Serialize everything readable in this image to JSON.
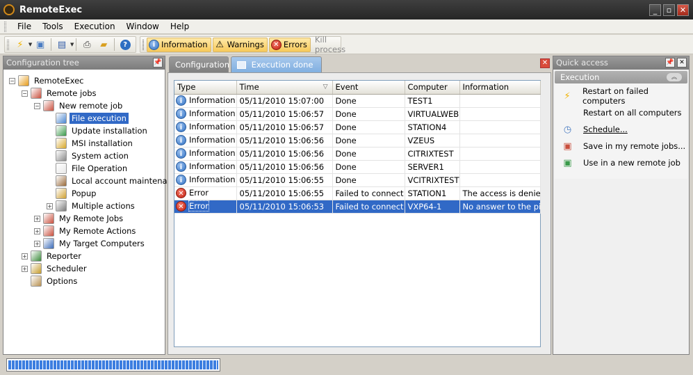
{
  "app": {
    "title": "RemoteExec"
  },
  "menu": [
    "File",
    "Tools",
    "Execution",
    "Window",
    "Help"
  ],
  "toolbar": {
    "icons": [
      "lightning-icon",
      "new-icon",
      "save-icon",
      "print-icon",
      "open-folder-icon",
      "help-icon"
    ],
    "filters": [
      {
        "label": "Information",
        "icon": "info-icon"
      },
      {
        "label": "Warnings",
        "icon": "warning-icon"
      },
      {
        "label": "Errors",
        "icon": "error-icon"
      }
    ],
    "kill_label": "Kill process"
  },
  "tree": {
    "title": "Configuration tree",
    "items": [
      {
        "label": "RemoteExec",
        "level": 0,
        "expander": "-"
      },
      {
        "label": "Remote jobs",
        "level": 1,
        "expander": "-"
      },
      {
        "label": "New remote job",
        "level": 2,
        "expander": "-"
      },
      {
        "label": "File execution",
        "level": 3,
        "expander": "",
        "selected": true
      },
      {
        "label": "Update installation",
        "level": 3,
        "expander": ""
      },
      {
        "label": "MSI installation",
        "level": 3,
        "expander": ""
      },
      {
        "label": "System action",
        "level": 3,
        "expander": ""
      },
      {
        "label": "File Operation",
        "level": 3,
        "expander": ""
      },
      {
        "label": "Local account maintenance",
        "level": 3,
        "expander": ""
      },
      {
        "label": "Popup",
        "level": 3,
        "expander": ""
      },
      {
        "label": "Multiple actions",
        "level": 3,
        "expander": "+"
      },
      {
        "label": "My Remote Jobs",
        "level": 2,
        "expander": "+"
      },
      {
        "label": "My Remote Actions",
        "level": 2,
        "expander": "+"
      },
      {
        "label": "My Target Computers",
        "level": 2,
        "expander": "+"
      },
      {
        "label": "Reporter",
        "level": 1,
        "expander": "+"
      },
      {
        "label": "Scheduler",
        "level": 1,
        "expander": "+"
      },
      {
        "label": "Options",
        "level": 1,
        "expander": ""
      }
    ]
  },
  "tabs": [
    {
      "label": "Configuration",
      "active": false
    },
    {
      "label": "Execution done",
      "active": true
    }
  ],
  "grid": {
    "columns": [
      "Type",
      "Time",
      "Event",
      "Computer",
      "Information"
    ],
    "rows": [
      {
        "type": "Information",
        "time": "05/11/2010 15:07:00",
        "event": "Done",
        "computer": "TEST1",
        "info": ""
      },
      {
        "type": "Information",
        "time": "05/11/2010 15:06:57",
        "event": "Done",
        "computer": "VIRTUALWEB",
        "info": ""
      },
      {
        "type": "Information",
        "time": "05/11/2010 15:06:57",
        "event": "Done",
        "computer": "STATION4",
        "info": ""
      },
      {
        "type": "Information",
        "time": "05/11/2010 15:06:56",
        "event": "Done",
        "computer": "VZEUS",
        "info": ""
      },
      {
        "type": "Information",
        "time": "05/11/2010 15:06:56",
        "event": "Done",
        "computer": "CITRIXTEST",
        "info": ""
      },
      {
        "type": "Information",
        "time": "05/11/2010 15:06:56",
        "event": "Done",
        "computer": "SERVER1",
        "info": ""
      },
      {
        "type": "Information",
        "time": "05/11/2010 15:06:55",
        "event": "Done",
        "computer": "VCITRIXTEST",
        "info": ""
      },
      {
        "type": "Error",
        "time": "05/11/2010 15:06:55",
        "event": "Failed to connect",
        "computer": "STATION1",
        "info": "The access is denied"
      },
      {
        "type": "Error",
        "time": "05/11/2010 15:06:53",
        "event": "Failed to connect",
        "computer": "VXP64-1",
        "info": "No answer to the ping.",
        "selected": true
      }
    ]
  },
  "quick_access": {
    "title": "Quick access",
    "section": "Execution",
    "items": [
      {
        "label": "Restart on failed computers",
        "icon": "lightning-icon",
        "link": false
      },
      {
        "label": "Restart on all computers",
        "icon": "",
        "link": false
      },
      {
        "label": "Schedule...",
        "icon": "schedule-icon",
        "link": true
      },
      {
        "label": "Save in my remote jobs...",
        "icon": "save-job-icon",
        "link": false
      },
      {
        "label": "Use in a new remote job",
        "icon": "new-job-icon",
        "link": false
      }
    ]
  },
  "status": {
    "progress": 1.0
  }
}
